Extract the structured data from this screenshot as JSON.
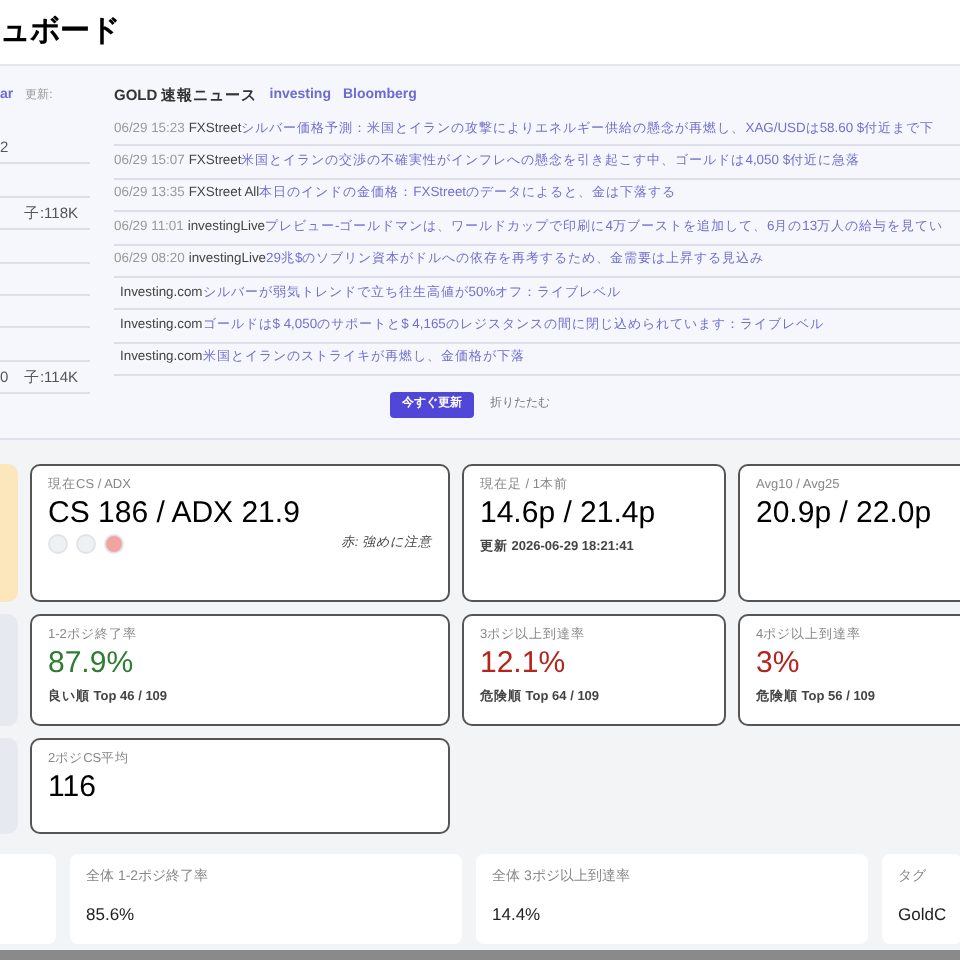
{
  "title": "ュボード",
  "left_column": {
    "header_link": "ar",
    "header_label": "更新:",
    "rows": [
      {
        "text": "2"
      },
      {},
      {
        "text": "子:118K"
      },
      {},
      {},
      {},
      {},
      {
        "lead": "0",
        "text": "子:114K"
      }
    ]
  },
  "news": {
    "title": "GOLD 速報ニュース",
    "links": [
      "investing",
      "Bloomberg"
    ],
    "items": [
      {
        "time": "06/29 15:23",
        "source": "FXStreet",
        "headline": "シルバー価格予測：米国とイランの攻撃によりエネルギー供給の懸念が再燃し、XAG/USDは58.60 $付近まで下"
      },
      {
        "time": "06/29 15:07",
        "source": "FXStreet",
        "headline": "米国とイランの交渉の不確実性がインフレへの懸念を引き起こす中、ゴールドは4,050 $付近に急落"
      },
      {
        "time": "06/29 13:35",
        "source": "FXStreet All",
        "headline": "本日のインドの金価格：FXStreetのデータによると、金は下落する"
      },
      {
        "time": "06/29 11:01",
        "source": "investingLive",
        "headline": "プレビュー-ゴールドマンは、ワールドカップで印刷に4万ブーストを追加して、6月の13万人の給与を見てい"
      },
      {
        "time": "06/29 08:20",
        "source": "investingLive",
        "headline": "29兆$のソブリン資本がドルへの依存を再考するため、金需要は上昇する見込み"
      },
      {
        "source": "Investing.com",
        "headline": "シルバーが弱気トレンドで立ち往生高値が50%オフ：ライブレベル"
      },
      {
        "source": "Investing.com",
        "headline": "ゴールドは$ 4,050のサポートと$ 4,165のレジスタンスの間に閉じ込められています：ライブレベル"
      },
      {
        "source": "Investing.com",
        "headline": "米国とイランのストライキが再燃し、金価格が下落"
      }
    ],
    "buttons": [
      {
        "label": "今すぐ更新",
        "kind": "primary"
      },
      {
        "label": "折りたたむ",
        "kind": "plain"
      }
    ]
  },
  "card_rows": [
    {
      "left_stub": {
        "color": "#fce7bd"
      },
      "cards": [
        {
          "kind": "dots",
          "label": "現在CS / ADX",
          "value": "CS 186 / ADX 21.9",
          "dots": [
            {
              "color": "#eef0f3"
            },
            {
              "color": "#eef0f3"
            },
            {
              "color": "#f4a3a3"
            }
          ],
          "note": "赤: 強めに注意"
        },
        {
          "kind": "plain",
          "label": "現在足 / 1本前",
          "value": "14.6p / 21.4p",
          "sub": "更新 2026-06-29 18:21:41"
        },
        {
          "kind": "plain",
          "label": "Avg10 / Avg25",
          "value": "20.9p / 22.0p"
        }
      ]
    },
    {
      "left_stub": {
        "color": "#e6eaf0"
      },
      "cards": [
        {
          "kind": "rate",
          "label": "1-2ポジ終了率",
          "value": "87.9%",
          "color": "#2e7d32",
          "sub": "良い順 Top 46 / 109"
        },
        {
          "kind": "rate",
          "label": "3ポジ以上到達率",
          "value": "12.1%",
          "color": "#b3261e",
          "sub": "危険順 Top 64 / 109"
        },
        {
          "kind": "rate",
          "label": "4ポジ以上到達率",
          "value": "3%",
          "color": "#b3261e",
          "sub": "危険順 Top 56 / 109"
        }
      ]
    },
    {
      "left_stub": {
        "color": "#e6eaf0"
      },
      "cards": [
        {
          "kind": "plain",
          "label": "2ポジCS平均",
          "value": "116"
        }
      ]
    }
  ],
  "summary": [
    {
      "label": "全体 1-2ポジ終了率",
      "value": "85.6%"
    },
    {
      "label": "全体 3ポジ以上到達率",
      "value": "14.4%"
    },
    {
      "label": "タグ",
      "value": "GoldC"
    }
  ]
}
